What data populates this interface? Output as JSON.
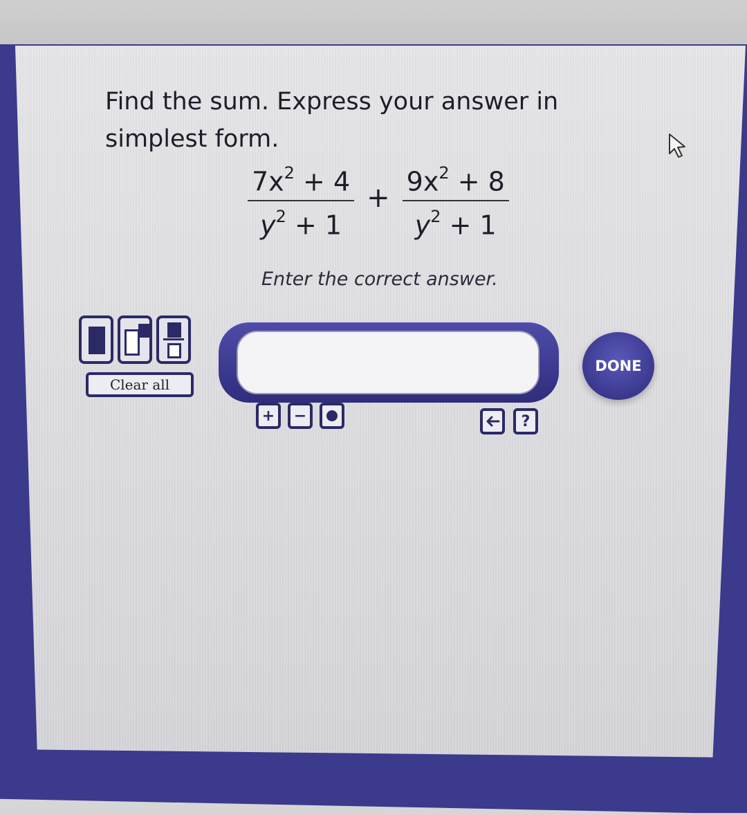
{
  "question": {
    "line": "Find the sum. Express your answer in simplest form."
  },
  "expression": {
    "frac1": {
      "num_a": "7x",
      "num_exp": "2",
      "num_b": " + 4",
      "den_a": "y",
      "den_exp": "2",
      "den_b": " + 1"
    },
    "operator": "+",
    "frac2": {
      "num_a": "9x",
      "num_exp": "2",
      "num_b": " + 8",
      "den_a": "y",
      "den_exp": "2",
      "den_b": " + 1"
    }
  },
  "instruction": "Enter the correct answer.",
  "answer": {
    "value": "",
    "placeholder": ""
  },
  "buttons": {
    "clear_all": "Clear all",
    "done": "DONE",
    "zoom_in": "+",
    "zoom_out": "−",
    "help": "?"
  },
  "icons": {
    "templates": [
      "box-template-icon",
      "superscript-template-icon",
      "fraction-template-icon"
    ],
    "zoom_reset": "dot-icon",
    "backspace": "backspace-arrow-icon",
    "cursor": "mouse-pointer-icon"
  },
  "colors": {
    "accent": "#3c3a8c",
    "button_border": "#2b2a66",
    "done_fill": "#3a3890"
  }
}
